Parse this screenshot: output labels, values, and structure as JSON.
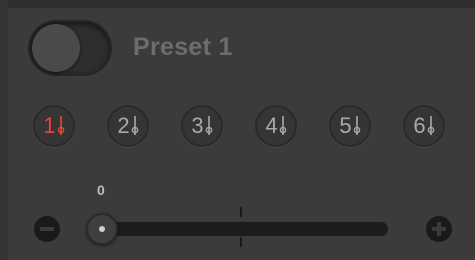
{
  "header": {
    "toggle_on": false,
    "title": "Preset 1"
  },
  "presets": [
    {
      "label": "1",
      "active": true
    },
    {
      "label": "2",
      "active": false
    },
    {
      "label": "3",
      "active": false
    },
    {
      "label": "4",
      "active": false
    },
    {
      "label": "5",
      "active": false
    },
    {
      "label": "6",
      "active": false
    }
  ],
  "slider": {
    "value_label": "0",
    "value": 0,
    "decrement_icon": "minus-icon",
    "increment_icon": "plus-icon"
  },
  "colors": {
    "background": "#3b3b3b",
    "active_accent": "#e04a3a",
    "inactive_text": "#a9a9a9",
    "title_text": "#6d6d6d"
  }
}
